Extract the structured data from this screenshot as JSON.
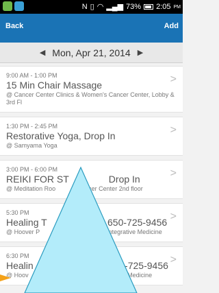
{
  "status_bar": {
    "battery": "73%",
    "time": "2:05",
    "ampm": "PM",
    "icons": [
      "notification-icon",
      "nfc-icon",
      "vibrate-icon",
      "wifi-icon",
      "signal-icon",
      "battery-icon"
    ]
  },
  "nav": {
    "back_label": "Back",
    "add_label": "Add"
  },
  "date_bar": {
    "date": "Mon, Apr 21, 2014"
  },
  "events": [
    {
      "time": "9:00 AM - 1:00 PM",
      "title": "15 Min Chair Massage",
      "location": "@ Cancer Center Clinics & Women's Cancer Center, Lobby & 3rd Fl"
    },
    {
      "time": "1:30 PM - 2:45 PM",
      "title": "Restorative Yoga, Drop In",
      "location": "@ Samyama Yoga"
    },
    {
      "time": "3:00 PM - 6:00 PM",
      "title": "REIKI FOR ST",
      "title_end": "Drop In",
      "location": "@ Meditation Roo",
      "location_end": "cer Center 2nd floor"
    },
    {
      "time": "5:30 PM",
      "title": "Healing T",
      "title_end": "er 650-725-9456",
      "location": "@ Hoover P",
      "location_end": "Integrative Medicine"
    },
    {
      "time": "6:30 PM",
      "title": "Healin",
      "title_end": "650-725-9456",
      "location": "@ Hoov",
      "location_end": "rative Medicine"
    }
  ],
  "colors": {
    "nav_blue": "#1a73b5",
    "overlay_fill": "#b3ecfa",
    "overlay_stroke": "#2a9bbf",
    "marker": "#f4a21a"
  }
}
